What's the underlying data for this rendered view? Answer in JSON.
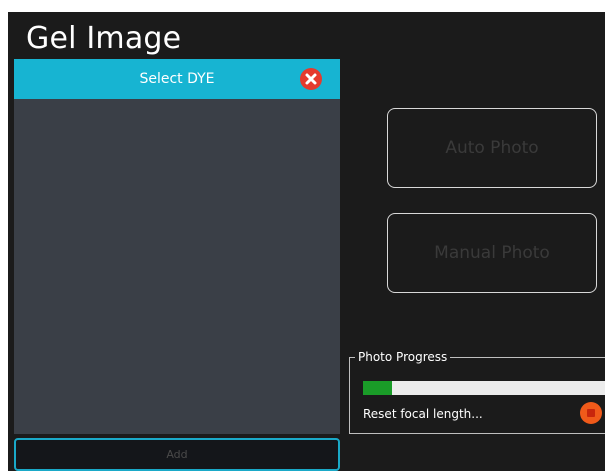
{
  "page": {
    "title": "Gel Image"
  },
  "dye_panel": {
    "header_label": "Select DYE",
    "close_icon": "close-icon",
    "items": []
  },
  "add_button": {
    "label": "Add"
  },
  "photo_buttons": {
    "auto_label": "Auto Photo",
    "manual_label": "Manual Photo"
  },
  "progress": {
    "group_label": "Photo Progress",
    "fraction": 0.12,
    "status_text": "Reset focal length...",
    "stop_icon": "stop-icon"
  },
  "colors": {
    "accent": "#17b4d2",
    "progress_fill": "#1a9c28",
    "close_red": "#e53a2e",
    "stop_orange": "#f05a1a",
    "background": "#1b1b1b",
    "panel": "#3a3f47"
  }
}
